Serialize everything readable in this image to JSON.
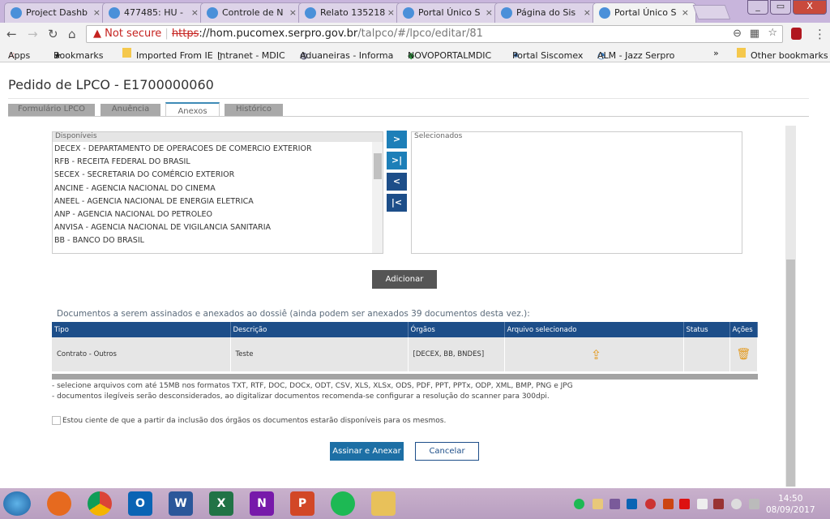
{
  "browser": {
    "tabs": [
      {
        "label": "Project Dashb",
        "active": false
      },
      {
        "label": "477485: HU -",
        "active": false
      },
      {
        "label": "Controle de N",
        "active": false
      },
      {
        "label": "Relato 135218",
        "active": false
      },
      {
        "label": "Portal Único S",
        "active": false
      },
      {
        "label": "Página do Sis",
        "active": false
      },
      {
        "label": "Portal Único S",
        "active": true
      }
    ],
    "not_secure": "Not secure",
    "url_scheme": "https",
    "url_host": "://hom.pucomex.serpro.gov.br",
    "url_path": "/talpco/#/lpco/editar/81",
    "bookmarks": [
      "Apps",
      "Bookmarks",
      "Imported From IE",
      "Intranet - MDIC",
      "Aduaneiras - Informa",
      "NOVOPORTALMDIC",
      "Portal Siscomex",
      "ALM - Jazz Serpro"
    ],
    "overflow": "»",
    "other_bookmarks": "Other bookmarks"
  },
  "page": {
    "title": "Pedido de LPCO - E1700000060",
    "tabs": [
      "Formulário LPCO",
      "Anuência",
      "Anexos",
      "Histórico"
    ],
    "active_tab": "Anexos",
    "available_label": "Disponíveis",
    "selected_label": "Selecionados",
    "available": [
      "DECEX - DEPARTAMENTO DE OPERACOES DE COMERCIO EXTERIOR",
      "RFB - RECEITA FEDERAL DO BRASIL",
      "SECEX - SECRETARIA DO COMÉRCIO EXTERIOR",
      "ANCINE - AGENCIA NACIONAL DO CINEMA",
      "ANEEL - AGENCIA NACIONAL DE ENERGIA ELETRICA",
      "ANP - AGENCIA NACIONAL DO PETROLEO",
      "ANVISA - AGENCIA NACIONAL DE VIGILANCIA SANITARIA",
      "BB - BANCO DO BRASIL"
    ],
    "move_buttons": [
      ">",
      ">|",
      "<",
      "|<"
    ],
    "add_button": "Adicionar",
    "docs_title": "Documentos a serem assinados e anexados ao dossiê (ainda podem ser anexados 39 documentos desta vez.):",
    "table": {
      "headers": [
        "Tipo",
        "Descrição",
        "Órgãos",
        "Arquivo selecionado",
        "Status",
        "Ações"
      ],
      "rows": [
        {
          "tipo": "Contrato - Outros",
          "descricao": "Teste",
          "orgaos": "[DECEX, BB, BNDES]",
          "status": ""
        }
      ]
    },
    "notes": [
      "- selecione arquivos com até 15MB nos formatos TXT, RTF, DOC, DOCx, ODT, CSV, XLS, XLSx, ODS, PDF, PPT, PPTx, ODP, XML, BMP, PNG e JPG",
      "- documentos ilegíveis serão desconsiderados, ao digitalizar documentos recomenda-se configurar a resolução do scanner para 300dpi."
    ],
    "checkbox_label": "Estou ciente de que a partir da inclusão dos órgãos os documentos estarão disponíveis para os mesmos.",
    "checkbox_checked": false,
    "sign_button": "Assinar e Anexar",
    "cancel_button": "Cancelar",
    "colors": {
      "header": "#1d4e89",
      "primary": "#1d6fa5",
      "accent_icon": "#e39a1f"
    }
  },
  "taskbar": {
    "apps": [
      "start",
      "firefox",
      "chrome",
      "outlook",
      "word",
      "excel",
      "onenote",
      "powerpoint",
      "spotify",
      "explorer"
    ],
    "time": "14:50",
    "date": "08/09/2017"
  }
}
